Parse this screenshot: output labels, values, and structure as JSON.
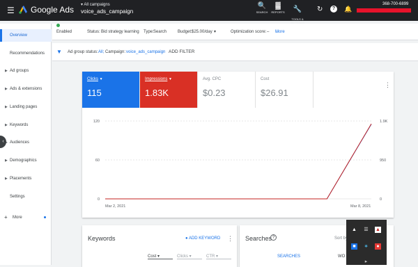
{
  "topbar": {
    "brand": "Google Ads",
    "breadcrumb_parent": "All campaigns",
    "breadcrumb_current": "voice_ads_campaign",
    "tools": [
      {
        "label": "SEARCH",
        "icon": "search-icon",
        "glyph": "🔍"
      },
      {
        "label": "REPORTS",
        "icon": "reports-icon",
        "glyph": "▓"
      },
      {
        "label": "TOOLS &\nSETTINGS",
        "icon": "wrench-icon",
        "glyph": "🔧"
      }
    ],
    "refresh_glyph": "↻",
    "help_glyph": "?",
    "bell_glyph": "🔔",
    "account_id": "368-700-6899"
  },
  "sidebar": {
    "items": [
      {
        "label": "Overview",
        "active": true,
        "expandable": false
      },
      {
        "label": "Recommendations",
        "expandable": false
      },
      {
        "label": "Ad groups",
        "expandable": true
      },
      {
        "label": "Ads & extensions",
        "expandable": true
      },
      {
        "label": "Landing pages",
        "expandable": true
      },
      {
        "label": "Keywords",
        "expandable": true
      },
      {
        "label": "Audiences",
        "expandable": true
      },
      {
        "label": "Demographics",
        "expandable": true
      },
      {
        "label": "Placements",
        "expandable": true
      },
      {
        "label": "Settings",
        "expandable": false
      },
      {
        "label": "More",
        "expandable": false,
        "plus": true
      }
    ]
  },
  "status": {
    "enabled": "Enabled",
    "status_label": "Status:",
    "status_value": "Bid strategy learning",
    "type_label": "Type:",
    "type_value": "Search",
    "budget_label": "Budget:",
    "budget_value": "$25.00/day",
    "optimization": "Optimization score:",
    "optimization_value": "–",
    "more_details": "More details"
  },
  "filter": {
    "status_label": "Ad group status:",
    "status_value": "All;",
    "campaign_label": "Campaign:",
    "campaign_value": "voice_ads_campaign",
    "add_filter": "ADD FILTER"
  },
  "metrics": [
    {
      "label": "Clicks",
      "value": "115"
    },
    {
      "label": "Impressions",
      "value": "1.83K"
    },
    {
      "label": "Avg. CPC",
      "value": "$0.23"
    },
    {
      "label": "Cost",
      "value": "$26.91"
    }
  ],
  "chart_data": {
    "type": "line",
    "x": [
      "Mar 2, 2021",
      "Mar 8, 2021"
    ],
    "xticks": [
      "Mar 2, 2021",
      "Mar 8, 2021"
    ],
    "y_left_ticks": [
      "0",
      "60",
      "120"
    ],
    "y_right_ticks": [
      "0",
      "950",
      "1.9K"
    ],
    "ylim_left": [
      0,
      120
    ],
    "ylim_right": [
      0,
      1900
    ],
    "series": [
      {
        "axis": "left",
        "color": "#4285f4",
        "values": [
          0,
          0,
          0,
          0,
          0,
          0,
          115
        ]
      },
      {
        "axis": "right",
        "color": "#c5221f",
        "values": [
          0,
          0,
          0,
          0,
          0,
          0,
          1830
        ]
      }
    ],
    "grid": true
  },
  "keywords_card": {
    "title": "Keywords",
    "add_keyword": "ADD KEYWORD",
    "columns": [
      "Cost",
      "Clicks",
      "CTR"
    ]
  },
  "searches_card": {
    "title": "Searches",
    "sort_by": "Sort by",
    "tab_searches": "SEARCHES",
    "tab_words": "WO"
  },
  "colors": {
    "accent_blue": "#1a73e8",
    "impressions_red": "#d93025",
    "enabled_green": "#34a853"
  }
}
